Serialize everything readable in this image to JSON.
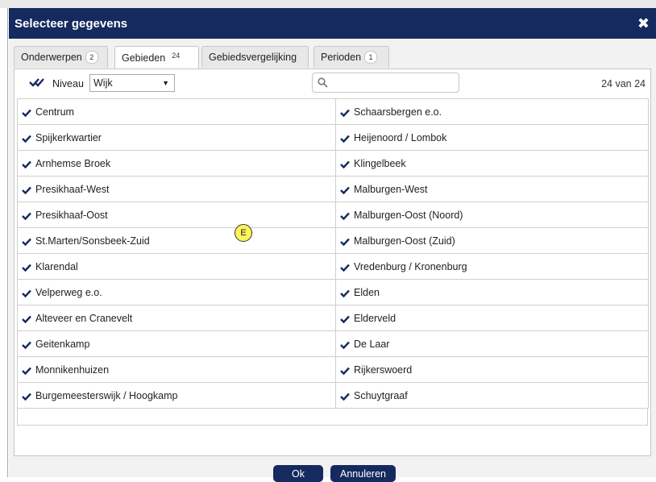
{
  "dialog": {
    "title": "Selecteer gegevens"
  },
  "tabs": [
    {
      "label": "Onderwerpen",
      "badge": "2"
    },
    {
      "label": "Gebieden",
      "badge": "24"
    },
    {
      "label": "Gebiedsvergelijking",
      "badge": ""
    },
    {
      "label": "Perioden",
      "badge": "1"
    }
  ],
  "toolbar": {
    "niveau_label": "Niveau",
    "niveau_value": "Wijk",
    "search_placeholder": "",
    "count": "24 van 24"
  },
  "areas_left": [
    "Centrum",
    "Spijkerkwartier",
    "Arnhemse Broek",
    "Presikhaaf-West",
    "Presikhaaf-Oost",
    "St.Marten/Sonsbeek-Zuid",
    "Klarendal",
    "Velperweg e.o.",
    "Alteveer en Cranevelt",
    "Geitenkamp",
    "Monnikenhuizen",
    "Burgemeesterswijk / Hoogkamp"
  ],
  "areas_right": [
    "Schaarsbergen e.o.",
    "Heijenoord / Lombok",
    "Klingelbeek",
    "Malburgen-West",
    "Malburgen-Oost (Noord)",
    "Malburgen-Oost (Zuid)",
    "Vredenburg / Kronenburg",
    "Elden",
    "Elderveld",
    "De Laar",
    "Rijkerswoerd",
    "Schuytgraaf"
  ],
  "annotation": "E",
  "buttons": {
    "ok": "Ok",
    "cancel": "Annuleren"
  },
  "colors": {
    "primary": "#152a5e"
  }
}
